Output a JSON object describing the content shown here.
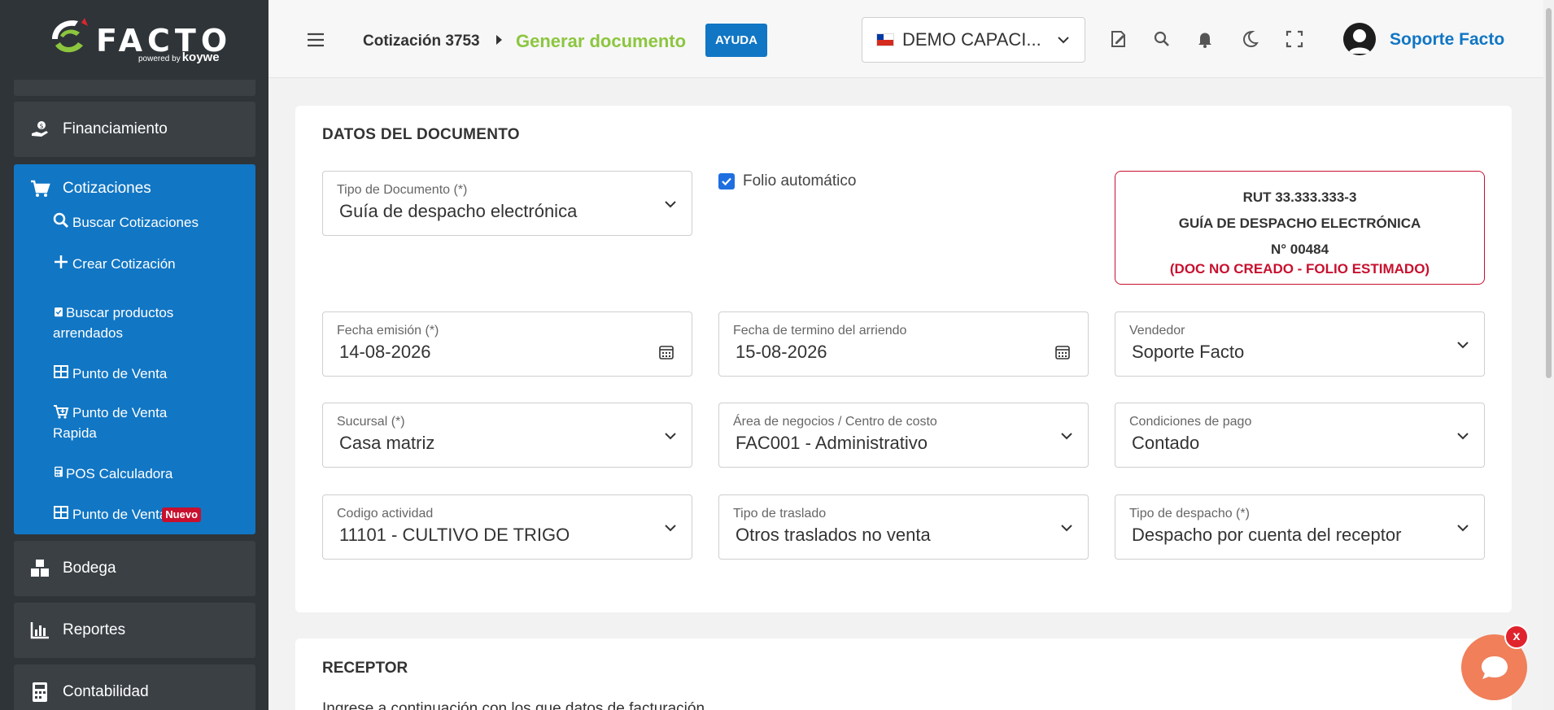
{
  "brand": {
    "logo_text": "FACTO",
    "powered": "powered by",
    "partner": "koywe"
  },
  "sidebar": {
    "financiamiento": "Financiamiento",
    "cotizaciones": {
      "label": "Cotizaciones",
      "items": [
        {
          "label": "Buscar Cotizaciones"
        },
        {
          "label": "Crear Cotización"
        },
        {
          "label": "Buscar productos",
          "label2": "arrendados"
        },
        {
          "label": "Punto de Venta"
        },
        {
          "label": "Punto de Venta",
          "label2": "Rapida"
        },
        {
          "label": "POS Calculadora"
        },
        {
          "label": "Punto de Venta",
          "badge": "Nuevo"
        }
      ]
    },
    "bodega": "Bodega",
    "reportes": "Reportes",
    "contabilidad": "Contabilidad"
  },
  "topbar": {
    "crumb1": "Cotización 3753",
    "crumb2": "Generar documento",
    "help": "AYUDA",
    "company": "DEMO CAPACI...",
    "user": "Soporte Facto"
  },
  "document": {
    "title": "DATOS DEL DOCUMENTO",
    "tipo_doc": {
      "label": "Tipo de Documento (*)",
      "value": "Guía de despacho electrónica"
    },
    "folio_auto": "Folio automático",
    "rut_box": {
      "rut": "RUT 33.333.333-3",
      "doc": "GUÍA DE DESPACHO ELECTRÓNICA",
      "num": "N° 00484",
      "status": "(DOC NO CREADO - FOLIO ESTIMADO)"
    },
    "fecha_emision": {
      "label": "Fecha emisión (*)",
      "value": "14-08-2026"
    },
    "fecha_termino": {
      "label": "Fecha de termino del arriendo",
      "value": "15-08-2026"
    },
    "vendedor": {
      "label": "Vendedor",
      "value": "Soporte Facto"
    },
    "sucursal": {
      "label": "Sucursal (*)",
      "value": "Casa matriz"
    },
    "area": {
      "label": "Área de negocios / Centro de costo",
      "value": "FAC001 - Administrativo"
    },
    "condiciones": {
      "label": "Condiciones de pago",
      "value": "Contado"
    },
    "actividad": {
      "label": "Codigo actividad",
      "value": "11101 - CULTIVO DE TRIGO"
    },
    "traslado": {
      "label": "Tipo de traslado",
      "value": "Otros traslados no venta"
    },
    "despacho": {
      "label": "Tipo de despacho (*)",
      "value": "Despacho por cuenta del receptor"
    }
  },
  "receptor": {
    "title": "RECEPTOR",
    "text": "Ingrese a continuación con los que datos de facturación"
  },
  "chat": {
    "close": "x"
  },
  "colors": {
    "primary": "#1176c4",
    "sidebar": "#2f3438",
    "accent_green": "#8cc63f",
    "alert_red": "#c8102e",
    "chat": "#f07f5a"
  }
}
